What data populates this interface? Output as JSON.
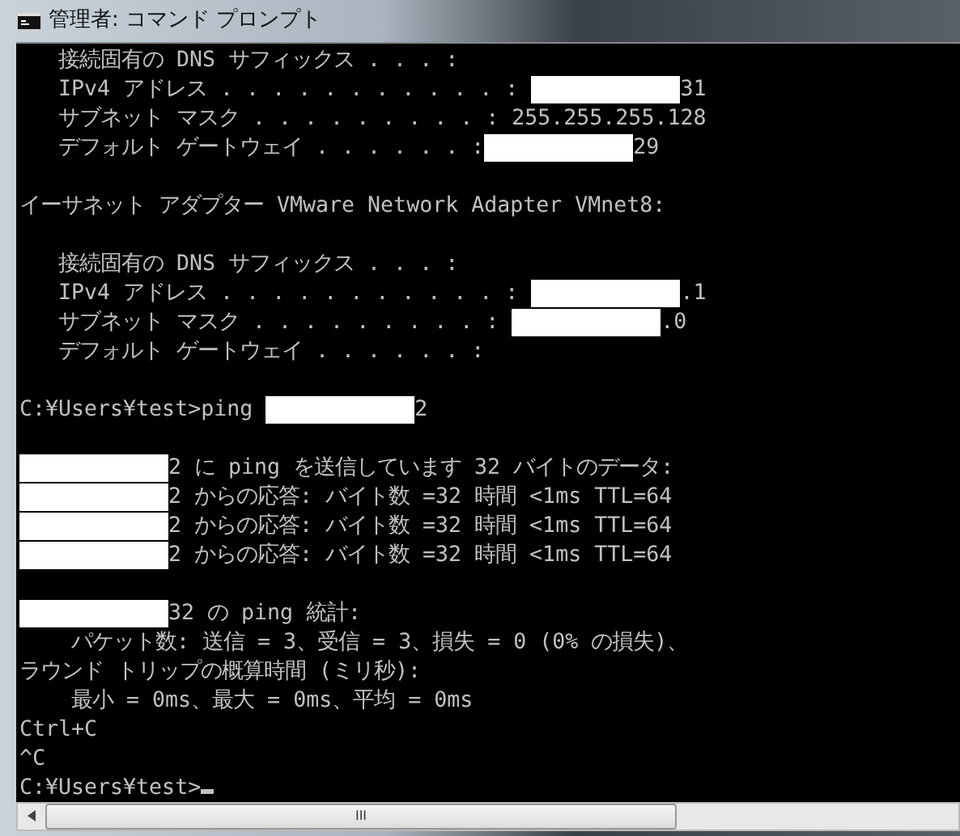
{
  "window": {
    "title": "管理者: コマンド プロンプト"
  },
  "console": {
    "lines": [
      {
        "segments": [
          {
            "kind": "text",
            "text": "   接続固有の DNS サフィックス . . . :"
          }
        ]
      },
      {
        "segments": [
          {
            "kind": "text",
            "text": "   IPv4 アドレス . . . . . . . . . . . : "
          },
          {
            "kind": "redaction"
          },
          {
            "kind": "text",
            "text": "31"
          }
        ]
      },
      {
        "segments": [
          {
            "kind": "text",
            "text": "   サブネット マスク . . . . . . . . . : 255.255.255.128"
          }
        ]
      },
      {
        "segments": [
          {
            "kind": "text",
            "text": "   デフォルト ゲートウェイ . . . . . . :"
          },
          {
            "kind": "redaction"
          },
          {
            "kind": "text",
            "text": "29"
          }
        ]
      },
      {
        "blank_before": true,
        "segments": [
          {
            "kind": "text",
            "text": "イーサネット アダプター VMware Network Adapter VMnet8:"
          }
        ]
      },
      {
        "blank_before": true,
        "segments": [
          {
            "kind": "text",
            "text": "   接続固有の DNS サフィックス . . . :"
          }
        ]
      },
      {
        "segments": [
          {
            "kind": "text",
            "text": "   IPv4 アドレス . . . . . . . . . . . : "
          },
          {
            "kind": "redaction"
          },
          {
            "kind": "text",
            "text": ".1"
          }
        ]
      },
      {
        "segments": [
          {
            "kind": "text",
            "text": "   サブネット マスク . . . . . . . . . : "
          },
          {
            "kind": "redaction"
          },
          {
            "kind": "text",
            "text": ".0"
          }
        ]
      },
      {
        "segments": [
          {
            "kind": "text",
            "text": "   デフォルト ゲートウェイ . . . . . . :"
          }
        ]
      },
      {
        "blank_before": true,
        "segments": [
          {
            "kind": "text",
            "text": "C:¥Users¥test>ping "
          },
          {
            "kind": "redaction"
          },
          {
            "kind": "text",
            "text": "2"
          }
        ]
      },
      {
        "blank_before": true,
        "segments": [
          {
            "kind": "redaction"
          },
          {
            "kind": "text",
            "text": "2 に ping を送信しています 32 バイトのデータ:"
          }
        ]
      },
      {
        "segments": [
          {
            "kind": "redaction"
          },
          {
            "kind": "text",
            "text": "2 からの応答: バイト数 =32 時間 <1ms TTL=64"
          }
        ]
      },
      {
        "segments": [
          {
            "kind": "redaction"
          },
          {
            "kind": "text",
            "text": "2 からの応答: バイト数 =32 時間 <1ms TTL=64"
          }
        ]
      },
      {
        "segments": [
          {
            "kind": "redaction"
          },
          {
            "kind": "text",
            "text": "2 からの応答: バイト数 =32 時間 <1ms TTL=64"
          }
        ]
      },
      {
        "blank_before": true,
        "segments": [
          {
            "kind": "redaction"
          },
          {
            "kind": "text",
            "text": "32 の ping 統計:"
          }
        ]
      },
      {
        "segments": [
          {
            "kind": "text",
            "text": "    パケット数: 送信 = 3、受信 = 3、損失 = 0 (0% の損失)、"
          }
        ]
      },
      {
        "segments": [
          {
            "kind": "text",
            "text": "ラウンド トリップの概算時間 (ミリ秒):"
          }
        ]
      },
      {
        "segments": [
          {
            "kind": "text",
            "text": "    最小 = 0ms、最大 = 0ms、平均 = 0ms"
          }
        ]
      },
      {
        "segments": [
          {
            "kind": "text",
            "text": "Ctrl+C"
          }
        ]
      },
      {
        "segments": [
          {
            "kind": "text",
            "text": "^C"
          }
        ]
      },
      {
        "segments": [
          {
            "kind": "text",
            "text": "C:¥Users¥test>"
          },
          {
            "kind": "cursor"
          }
        ]
      }
    ]
  },
  "scrollbar": {
    "grip": "III"
  }
}
